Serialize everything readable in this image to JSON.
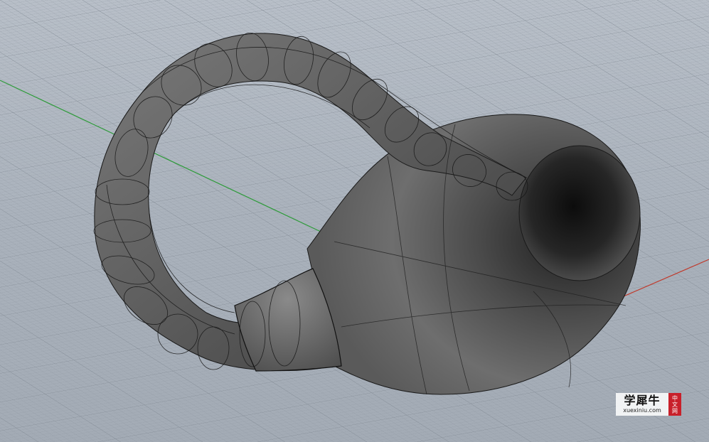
{
  "viewport": {
    "name": "3D perspective viewport",
    "object": "klein-bottle-surface",
    "axes": {
      "x_color": "#c0392b",
      "y_color": "#2e9b3a"
    },
    "grid_color": "#8d959f",
    "background_color": "#adb5bf",
    "surface_color": "#5a5a5a"
  },
  "watermark": {
    "title": "学犀牛",
    "url": "xuexiniu.com",
    "badge_chars": [
      "中",
      "文",
      "网"
    ],
    "badge_color": "#c8202a"
  }
}
